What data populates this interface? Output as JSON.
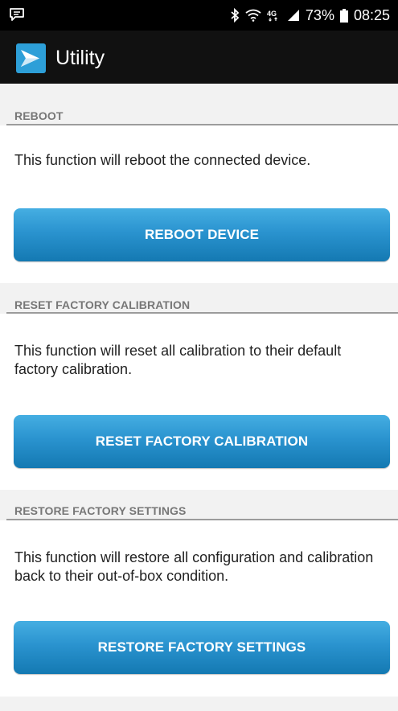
{
  "status_bar": {
    "icons": [
      "message-icon",
      "bluetooth-icon",
      "wifi-icon",
      "lte-icon",
      "signal-icon",
      "battery-icon"
    ],
    "network_label": "4G",
    "battery_percent": "73%",
    "time": "08:25"
  },
  "app_bar": {
    "title": "Utility",
    "logo_icon": "app-logo-icon"
  },
  "sections": [
    {
      "header": "REBOOT",
      "description": "This function will reboot the connected device.",
      "button_label": "REBOOT DEVICE"
    },
    {
      "header": "RESET FACTORY CALIBRATION",
      "description": "This function will reset all calibration to their default factory calibration.",
      "button_label": "RESET FACTORY CALIBRATION"
    },
    {
      "header": "RESTORE FACTORY SETTINGS",
      "description": "This function will restore all configuration and calibration back to their out-of-box condition.",
      "button_label": "RESTORE FACTORY SETTINGS"
    }
  ],
  "colors": {
    "button_top": "#45aee2",
    "button_bottom": "#1479b2",
    "header_bg": "#f2f2f2",
    "header_text": "#777777",
    "app_bar_bg": "#111111"
  }
}
